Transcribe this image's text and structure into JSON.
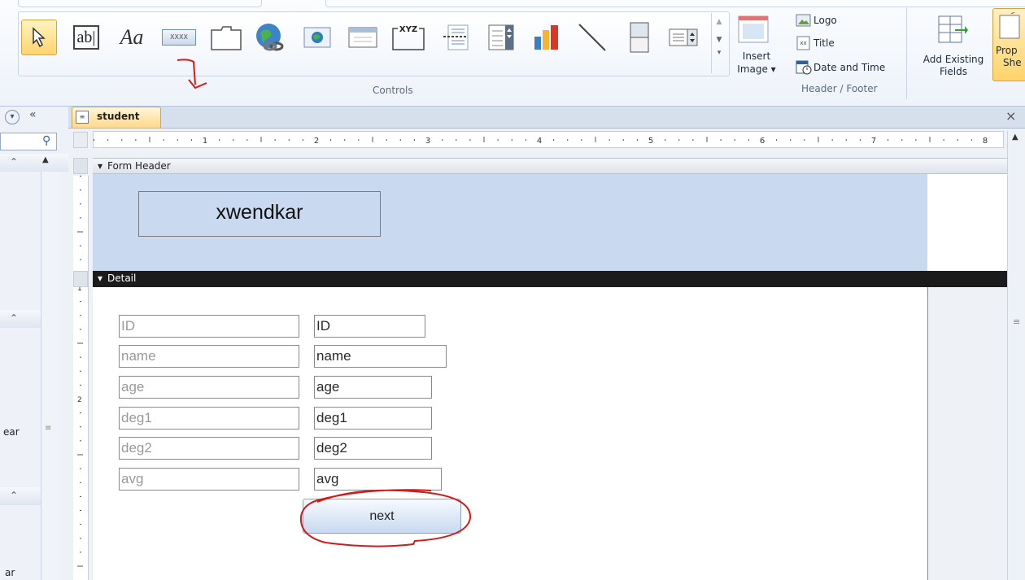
{
  "ribbon": {
    "controls_group": "Controls",
    "header_footer_group": "Header / Footer",
    "insert_image": "Insert",
    "insert_image_2": "Image ▾",
    "logo": "Logo",
    "title": "Title",
    "date_time": "Date and Time",
    "add_existing": "Add Existing",
    "add_existing_2": "Fields",
    "property_sheet": "Prop",
    "property_sheet_2": "She",
    "textbox_icon_text": "ab|",
    "label_icon_text": "Aa",
    "button_icon_text": "XXXX",
    "xyz_text": "XYZ"
  },
  "document": {
    "tab_title": "student",
    "close": "×"
  },
  "nav": {
    "collapse_left": "«",
    "dropdown": "▾",
    "fragment_1": "ear",
    "fragment_2": "ar"
  },
  "form": {
    "header_section": "Form Header",
    "detail_section": "Detail",
    "title_label": "xwendkar",
    "fields": [
      {
        "label": "ID",
        "value": "ID"
      },
      {
        "label": "name",
        "value": "name"
      },
      {
        "label": "age",
        "value": "age"
      },
      {
        "label": "deg1",
        "value": "deg1"
      },
      {
        "label": "deg2",
        "value": "deg2"
      },
      {
        "label": "avg",
        "value": "avg"
      }
    ],
    "next_button": "next"
  },
  "ruler": {
    "marks": [
      "1",
      "2",
      "3",
      "4",
      "5",
      "6",
      "7",
      "8"
    ],
    "vmarks": [
      "1",
      "2"
    ]
  },
  "colors": {
    "header_band": "#c9d9ef",
    "section_bar_dark": "#1a1a1a",
    "annotation_red": "#d11a1a"
  }
}
